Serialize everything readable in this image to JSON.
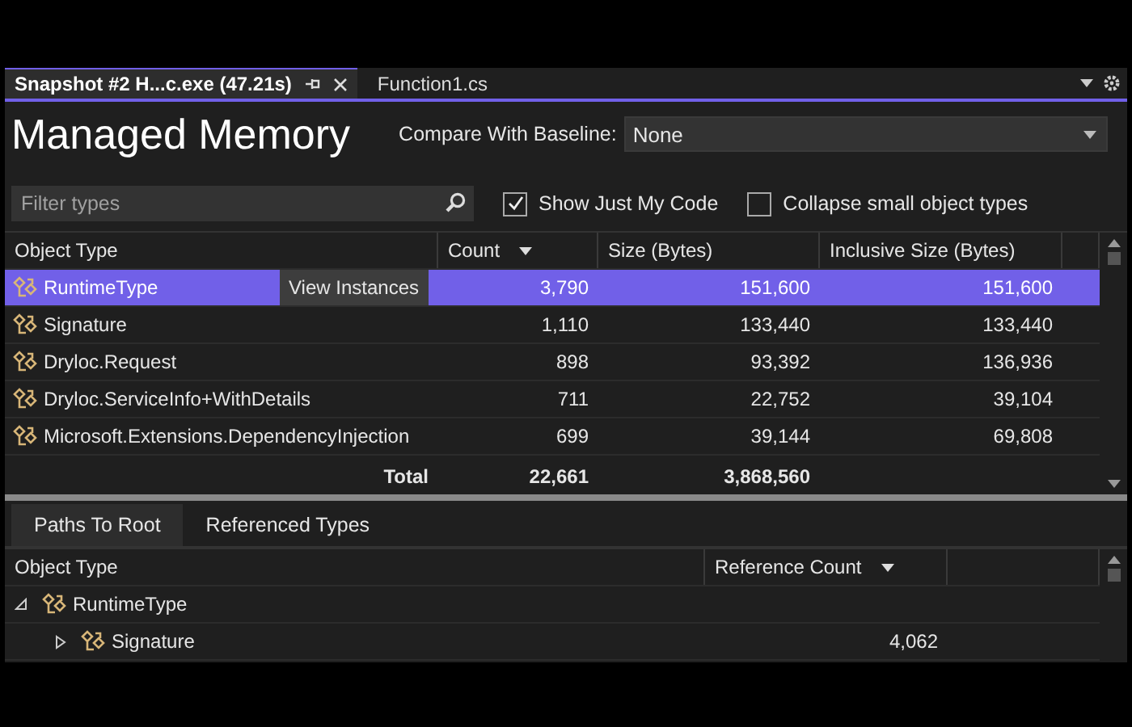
{
  "doc_tabs": [
    {
      "label": "Snapshot #2 H...c.exe (47.21s)",
      "selected": true
    },
    {
      "label": "Function1.cs",
      "selected": false
    }
  ],
  "title": "Managed Memory",
  "baseline": {
    "label": "Compare With Baseline:",
    "value": "None"
  },
  "filter": {
    "placeholder": "Filter types"
  },
  "checkboxes": [
    {
      "label": "Show Just My Code",
      "checked": true
    },
    {
      "label": "Collapse small object types",
      "checked": false
    }
  ],
  "types_table": {
    "columns": [
      {
        "label": "Object Type",
        "sorted": false
      },
      {
        "label": "Count",
        "sorted": true
      },
      {
        "label": "Size (Bytes)",
        "sorted": false
      },
      {
        "label": "Inclusive Size (Bytes)",
        "sorted": false
      }
    ],
    "hover_button": "View Instances",
    "rows": [
      {
        "cells": [
          "RuntimeType",
          "3,790",
          "151,600",
          "151,600"
        ],
        "selected": true
      },
      {
        "cells": [
          "Signature",
          "1,110",
          "133,440",
          "133,440"
        ],
        "selected": false
      },
      {
        "cells": [
          "Dryloc.Request",
          "898",
          "93,392",
          "136,936"
        ],
        "selected": false
      },
      {
        "cells": [
          "Dryloc.ServiceInfo+WithDetails",
          "711",
          "22,752",
          "39,104"
        ],
        "selected": false
      },
      {
        "cells": [
          "Microsoft.Extensions.DependencyInjection",
          "699",
          "39,144",
          "69,808"
        ],
        "selected": false
      }
    ],
    "total": {
      "label": "Total",
      "values": [
        "22,661",
        "3,868,560"
      ]
    }
  },
  "bottom_tabs": [
    {
      "label": "Paths To Root",
      "selected": true
    },
    {
      "label": "Referenced Types",
      "selected": false
    }
  ],
  "paths_table": {
    "columns": [
      {
        "label": "Object Type",
        "sorted": false
      },
      {
        "label": "Reference Count",
        "sorted": true
      }
    ],
    "rows": [
      {
        "name": "RuntimeType",
        "expanded": true,
        "children": [
          {
            "name": "Signature",
            "count": "4,062",
            "expanded": false
          }
        ]
      }
    ]
  }
}
